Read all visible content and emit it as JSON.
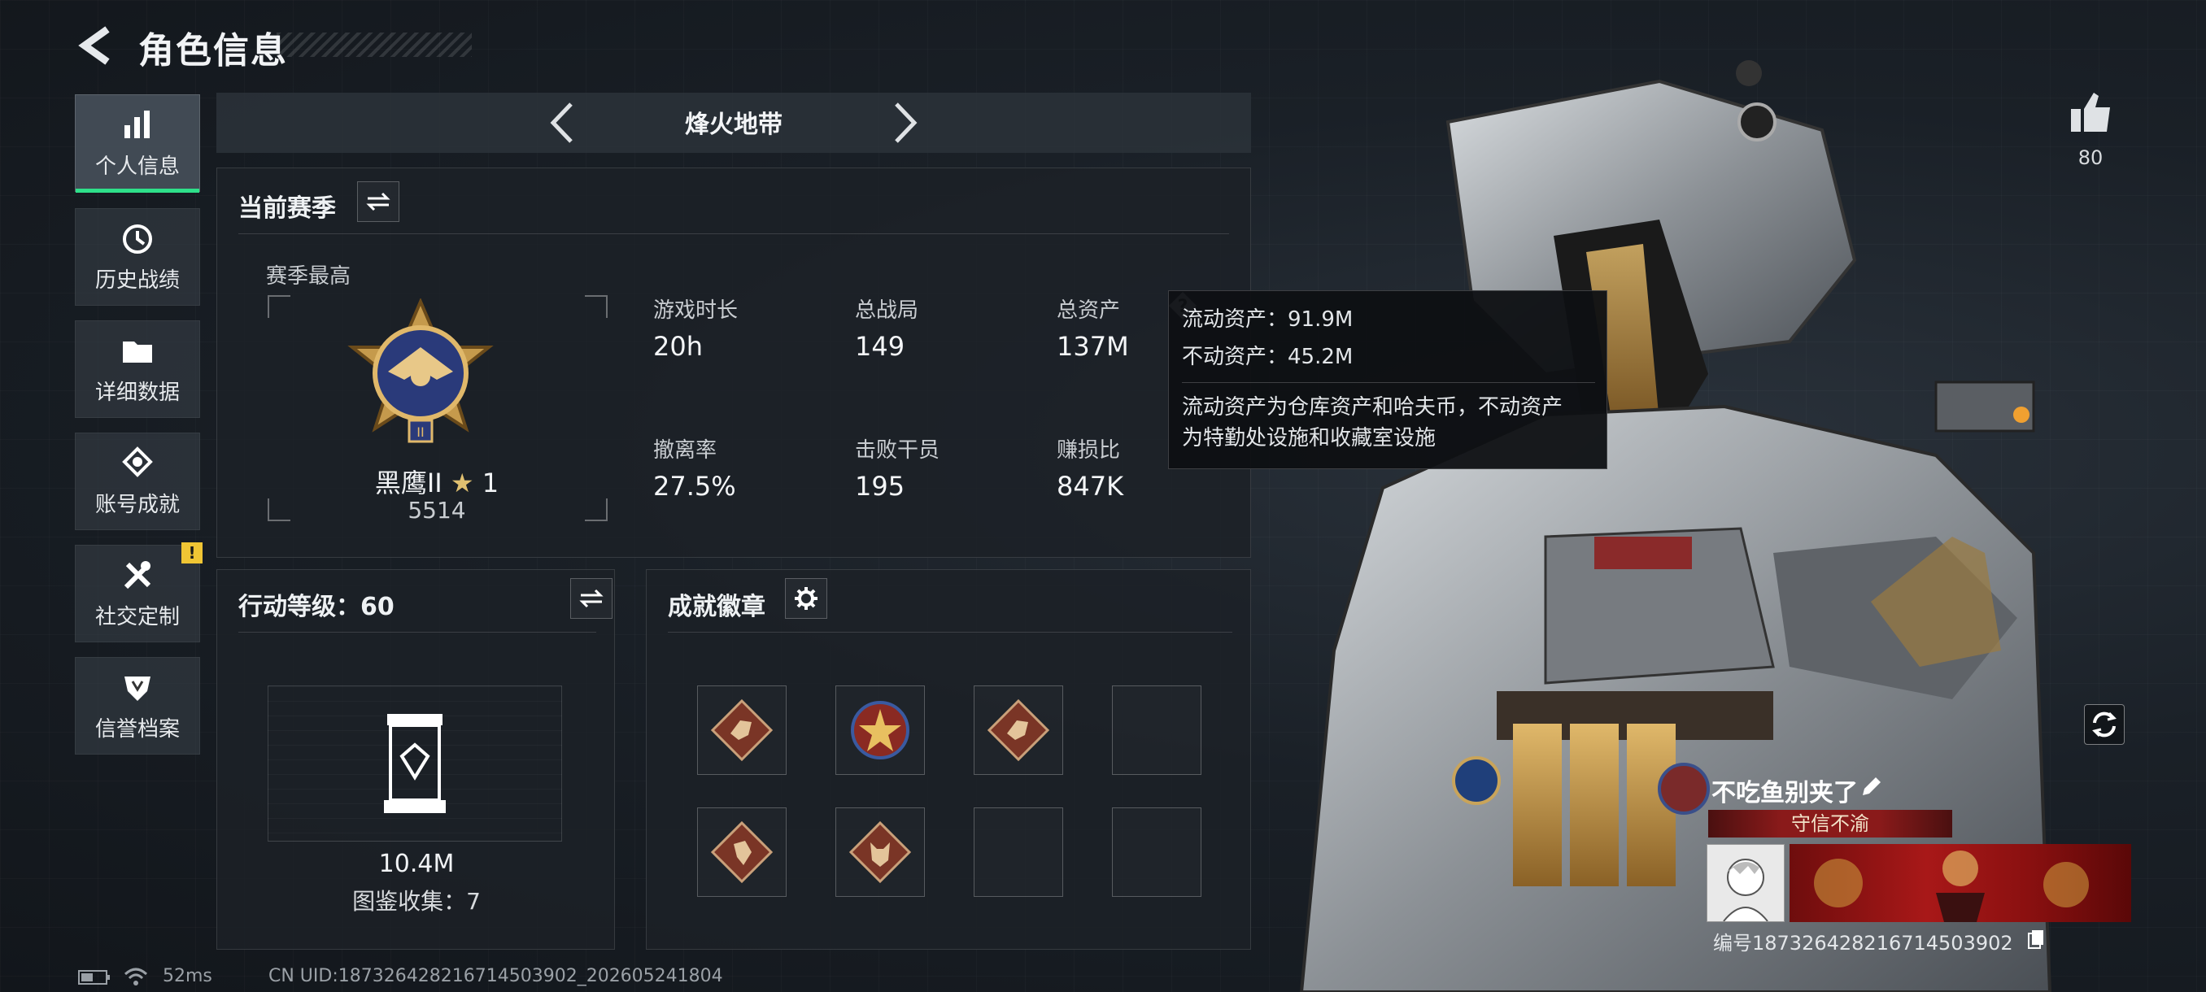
{
  "header": {
    "title": "角色信息"
  },
  "sidebar": {
    "items": [
      {
        "label": "个人信息",
        "icon": "bar-chart-icon",
        "active": true
      },
      {
        "label": "历史战绩",
        "icon": "history-icon"
      },
      {
        "label": "详细数据",
        "icon": "folder-icon"
      },
      {
        "label": "账号成就",
        "icon": "achievement-icon"
      },
      {
        "label": "社交定制",
        "icon": "tools-icon",
        "badge": "!"
      },
      {
        "label": "信誉档案",
        "icon": "shield-icon"
      }
    ]
  },
  "mode": {
    "name": "烽火地带"
  },
  "season": {
    "title": "当前赛季",
    "best_label": "赛季最高",
    "rank_name": "黑鹰II",
    "rank_star": "★",
    "rank_stars": "1",
    "rank_score": "5514",
    "stats": [
      {
        "label": "游戏时长",
        "value": "20h"
      },
      {
        "label": "总战局",
        "value": "149"
      },
      {
        "label": "总资产",
        "value": "137M"
      },
      {
        "label": "撤离率",
        "value": "27.5%"
      },
      {
        "label": "击败干员",
        "value": "195"
      },
      {
        "label": "赚损比",
        "value": "847K"
      }
    ]
  },
  "tooltip": {
    "liquid": "流动资产：91.9M",
    "fixed": "不动资产：45.2M",
    "desc_line1": "流动资产为仓库资产和哈夫币，不动资产",
    "desc_line2": "为特勤处设施和收藏室设施"
  },
  "action": {
    "title": "行动等级：60",
    "value": "10.4M",
    "collection": "图鉴收集：7"
  },
  "achievements": {
    "title": "成就徽章",
    "badges": [
      "dragon-badge",
      "star-emblem-badge",
      "dragon-badge",
      "empty",
      "runner-badge",
      "wolf-badge",
      "empty",
      "empty"
    ]
  },
  "profile": {
    "likes": "80",
    "name": "不吃鱼别夹了",
    "title": "守信不渝",
    "id": "编号1873264282167145039​02"
  },
  "status": {
    "ping": "52ms",
    "uid": "CN UID:1873264282167145039​02_202605241804"
  },
  "colors": {
    "accent": "#2ee08a",
    "warn": "#f0c534",
    "title_red": "#8a1a1a"
  }
}
